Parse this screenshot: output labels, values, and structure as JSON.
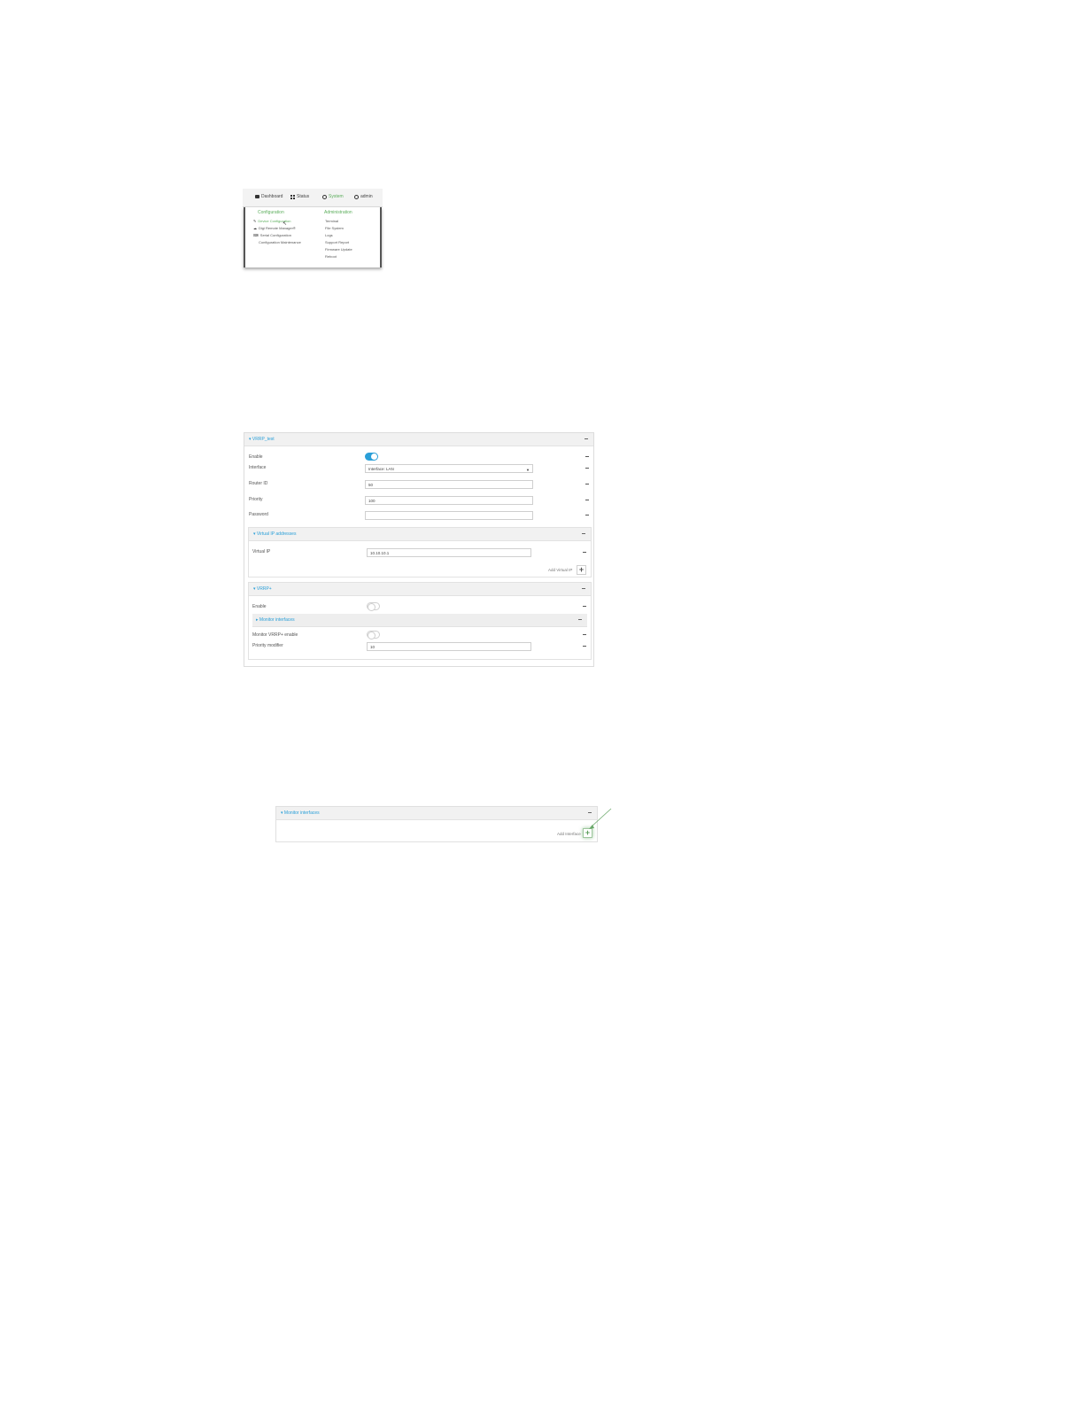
{
  "menu": {
    "nav": {
      "dashboard": "Dashboard",
      "status": "Status",
      "system": "System",
      "admin": "admin"
    },
    "configuration": {
      "heading": "Configuration",
      "items": [
        "Device Configuration",
        "Digi Remote Manager®",
        "Serial Configuration",
        "Configuration Maintenance"
      ]
    },
    "administration": {
      "heading": "Administration",
      "items": [
        "Terminal",
        "File System",
        "Logs",
        "Support Report",
        "Firmware Update",
        "Reboot"
      ]
    },
    "accent_color": "#5cae5c"
  },
  "form": {
    "section_title": "▾ VRRP_test",
    "fields": {
      "enable_label": "Enable",
      "enable_value": true,
      "interface_label": "Interface",
      "interface_value": "Interface: LAN",
      "router_id_label": "Router ID",
      "router_id_value": "50",
      "priority_label": "Priority",
      "priority_value": "100",
      "password_label": "Password",
      "password_value": ""
    },
    "virtual_ip": {
      "section_title": "▾ Virtual IP addresses",
      "label": "Virtual IP",
      "value": "10.10.10.1",
      "add_label": "Add Virtual IP"
    },
    "vrrp_plus": {
      "section_title": "▾ VRRP+",
      "enable_label": "Enable",
      "enable_value": false,
      "monitor_section_title": "▸ Monitor interfaces",
      "monitor_enable_label": "Monitor VRRP+ enable",
      "monitor_enable_value": false,
      "priority_modifier_label": "Priority modifier",
      "priority_modifier_value": "10"
    },
    "accent_color": "#2a9fd8"
  },
  "monitor": {
    "section_title": "▾ Monitor interfaces",
    "add_label": "Add Interface",
    "highlight_color": "#5a9e5a"
  }
}
